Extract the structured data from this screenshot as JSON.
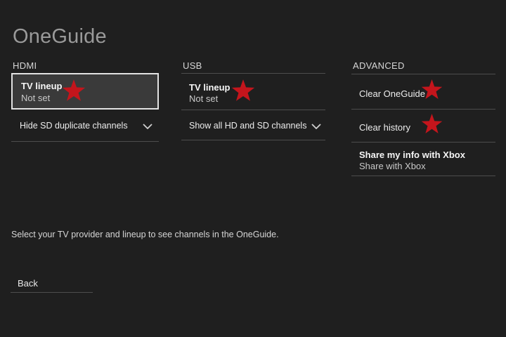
{
  "page": {
    "title": "OneGuide"
  },
  "accent": {
    "star_color": "#c4151c"
  },
  "columns": {
    "hdmi": {
      "header": "HDMI",
      "tv_lineup": {
        "title": "TV lineup",
        "value": "Not set",
        "starred": true,
        "focused": true
      },
      "dropdown": {
        "label": "Hide SD duplicate channels"
      }
    },
    "usb": {
      "header": "USB",
      "tv_lineup": {
        "title": "TV lineup",
        "value": "Not set",
        "starred": true
      },
      "dropdown": {
        "label": "Show all HD and SD channels"
      }
    },
    "advanced": {
      "header": "ADVANCED",
      "items": [
        {
          "label": "Clear OneGuide",
          "starred": true
        },
        {
          "label": "Clear history",
          "starred": true
        },
        {
          "title": "Share my info with Xbox",
          "value": "Share with Xbox"
        }
      ]
    }
  },
  "footer": {
    "hint": "Select your TV provider and lineup to see channels in the OneGuide.",
    "back_label": "Back"
  }
}
